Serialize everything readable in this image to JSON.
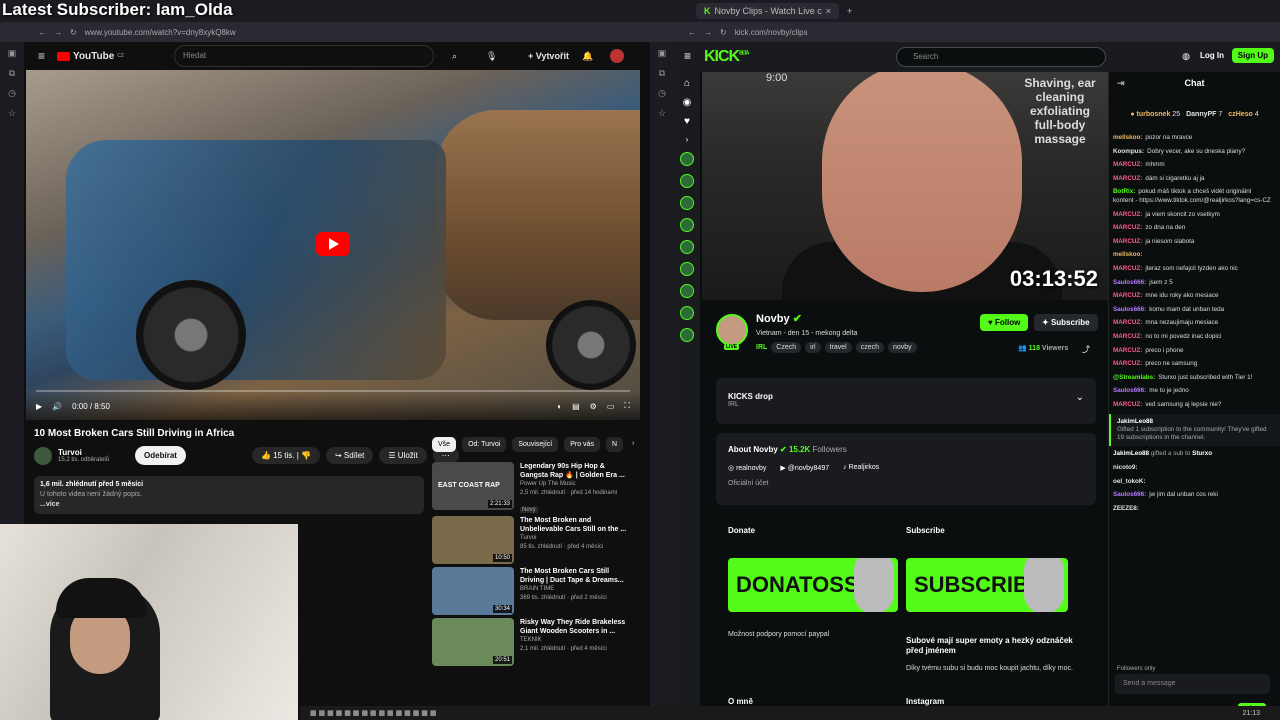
{
  "overlay": {
    "subscriber": "Latest Subscriber: Iam_Olda"
  },
  "left_browser": {
    "url": "www.youtube.com/watch?v=dny8xykQ8kw",
    "logo": "YouTube",
    "region": "CZ",
    "search_placeholder": "Hledat",
    "create_label": "Vytvořit",
    "video": {
      "title": "10 Most Broken Cars Still Driving in Africa",
      "time": "0:00 / 8:50",
      "channel": "Turvoi",
      "subs": "15,2 tis. odběratelů",
      "subscribe_label": "Odebírat",
      "likes": "15 tis.",
      "share_label": "Sdílet",
      "save_label": "Uložit",
      "views": "1,6 mil. zhlédnutí  před 5 měsíci",
      "no_desc": "U tohoto videa není žádný popis.",
      "more": "...více"
    },
    "chips": [
      "Vše",
      "Od: Turvoi",
      "Související",
      "Pro vás",
      "N"
    ],
    "recommendations": [
      {
        "title": "Legendary 90s Hip Hop & Gangsta Rap 🔥 | Golden Era ...",
        "channel": "Power Up The Music",
        "meta": "2,5 mil. zhlédnutí · před 14 hodinami",
        "badge": "Nový",
        "duration": "2:21:33",
        "thumb_text": "EAST COAST RAP",
        "color": "#4a4a4a"
      },
      {
        "title": "The Most Broken and Unbelievable Cars Still on the ...",
        "channel": "Turvoi",
        "meta": "85 tis. zhlédnutí · před 4 měsíci",
        "duration": "10:50",
        "color": "#7a6a4a"
      },
      {
        "title": "The Most Broken Cars Still Driving | Duct Tape & Dreams...",
        "channel": "BRAIN TIME",
        "meta": "369 tis. zhlédnutí · před 2 měsíci",
        "duration": "30:34",
        "color": "#5a7a9a"
      },
      {
        "title": "Risky Way They Ride Brakeless Giant Wooden Scooters in ...",
        "channel": "TEKNIK",
        "meta": "2,1 mil. zhlédnutí · před 4 měsíci",
        "duration": "20:51",
        "color": "#6a8a5a"
      }
    ]
  },
  "right_browser": {
    "tab_title": "Novby Clips - Watch Live c",
    "url": "kick.com/novby/clips",
    "logo": "KICK",
    "logo_tag": "BETA",
    "search_placeholder": "Search",
    "login_label": "Log In",
    "signup_label": "Sign Up",
    "stream": {
      "timer": "03:13:52",
      "clock": "9:00",
      "sign": "Shaving, ear cleaning exfoliating full-body massage",
      "streamer": "Novby",
      "title": "Vietnam - den 15 - mekong delta",
      "category": "IRL",
      "tags": [
        "Czech",
        "irl",
        "travel",
        "czech",
        "novby"
      ],
      "follow_label": "Follow",
      "subscribe_label": "Subscribe",
      "viewers": "118",
      "viewers_label": "Viewers",
      "live_badge": "LIVE"
    },
    "drops": {
      "title": "KICKS drop",
      "sub": "IRL"
    },
    "about": {
      "title": "About Novby",
      "followers": "15.2K",
      "followers_label": "Followers",
      "socials": [
        "realnovby",
        "@novby8497",
        "Realjirkos"
      ],
      "official": "Oficiální účet"
    },
    "panels": {
      "donate_title": "Donate",
      "donate_banner": "DONATOSS",
      "donate_text": "Možnost podpory pomocí paypal",
      "subscribe_title": "Subscribe",
      "subscribe_banner": "SUBSCRIBE",
      "subscribe_text_bold": "Subové mají super emoty a hezký odznáček před jménem",
      "subscribe_text": "Díky tvému subu si budu moc koupit jachtu, díky moc.",
      "about_me": "O mně",
      "instagram": "Instagram"
    },
    "chat": {
      "header": "Chat",
      "gifters": [
        {
          "name": "turbosnek",
          "count": "25"
        },
        {
          "name": "DannyPF",
          "count": "7"
        },
        {
          "name": "czHeso",
          "count": "4"
        }
      ],
      "messages": [
        {
          "user": "mellskoo:",
          "text": "pozor na mravce",
          "color": "#f0b860"
        },
        {
          "user": "Koompus:",
          "text": "Dobry vecer, ake su dneska plany?",
          "color": "#e0e0e0"
        },
        {
          "user": "MARCUZ:",
          "text": "mhmm",
          "color": "#ff5c8a"
        },
        {
          "user": "MARCUZ:",
          "text": "dám si cigaretku aj ja",
          "color": "#ff5c8a"
        },
        {
          "user": "BotRix:",
          "text": "pokud máš tiktok a chceš vidět originální kontent - https://www.tiktok.com/@realjirkos?lang=cs-CZ",
          "color": "#53fc18"
        },
        {
          "user": "MARCUZ:",
          "text": "ja viem skoncit zo vsetkym",
          "color": "#ff5c8a"
        },
        {
          "user": "MARCUZ:",
          "text": "zo dna na den",
          "color": "#ff5c8a"
        },
        {
          "user": "MARCUZ:",
          "text": "ja niesom slabota",
          "color": "#ff5c8a"
        },
        {
          "user": "mellskoo:",
          "text": "",
          "color": "#f0b860"
        },
        {
          "user": "MARCUZ:",
          "text": "jteraz som nefajcil tyzden ako nic",
          "color": "#ff5c8a"
        },
        {
          "user": "Saulos666:",
          "text": "jsem z 5",
          "color": "#b57cff"
        },
        {
          "user": "MARCUZ:",
          "text": "mne idu roky ako mesiace",
          "color": "#ff5c8a"
        },
        {
          "user": "Saulos666:",
          "text": "komu mam dat unban teda",
          "color": "#b57cff"
        },
        {
          "user": "MARCUZ:",
          "text": "mna nezaujimaju mesiace",
          "color": "#ff5c8a"
        },
        {
          "user": "MARCUZ:",
          "text": "no to mi povedz inac dopici",
          "color": "#ff5c8a"
        },
        {
          "user": "MARCUZ:",
          "text": "preco i phone",
          "color": "#ff5c8a"
        },
        {
          "user": "MARCUZ:",
          "text": "preco ne samsung",
          "color": "#ff5c8a"
        },
        {
          "user": "@Streamlabs:",
          "text": "Sturxo just subscribed with Tier 1!",
          "color": "#53fc18"
        },
        {
          "user": "Saulos666:",
          "text": "me to je jedno",
          "color": "#b57cff"
        },
        {
          "user": "MARCUZ:",
          "text": "ved samsung aj lepsie nie?",
          "color": "#ff5c8a"
        }
      ],
      "gift_event": {
        "user": "JakimLeo88",
        "text": "Gifted 1 subscription to the community! They've gifted 19 subscriptions in the channel."
      },
      "gift_sub": {
        "user": "JakimLeo88",
        "text": "gifted a sub to",
        "target": "Sturxo"
      },
      "after": [
        {
          "user": "nicoto9:",
          "text": "",
          "color": "#e0e0e0"
        },
        {
          "user": "oel_tokoK:",
          "text": "",
          "color": "#e0e0e0"
        },
        {
          "user": "Saulos666:",
          "text": "jw jim dal unban cos reki",
          "color": "#b57cff"
        },
        {
          "user": "ZEEZE8:",
          "text": "",
          "color": "#e0e0e0"
        }
      ],
      "followers_only": "Followers only",
      "input_placeholder": "Send a message",
      "send_label": "Chat"
    }
  },
  "taskbar": {
    "time": "21:13"
  }
}
